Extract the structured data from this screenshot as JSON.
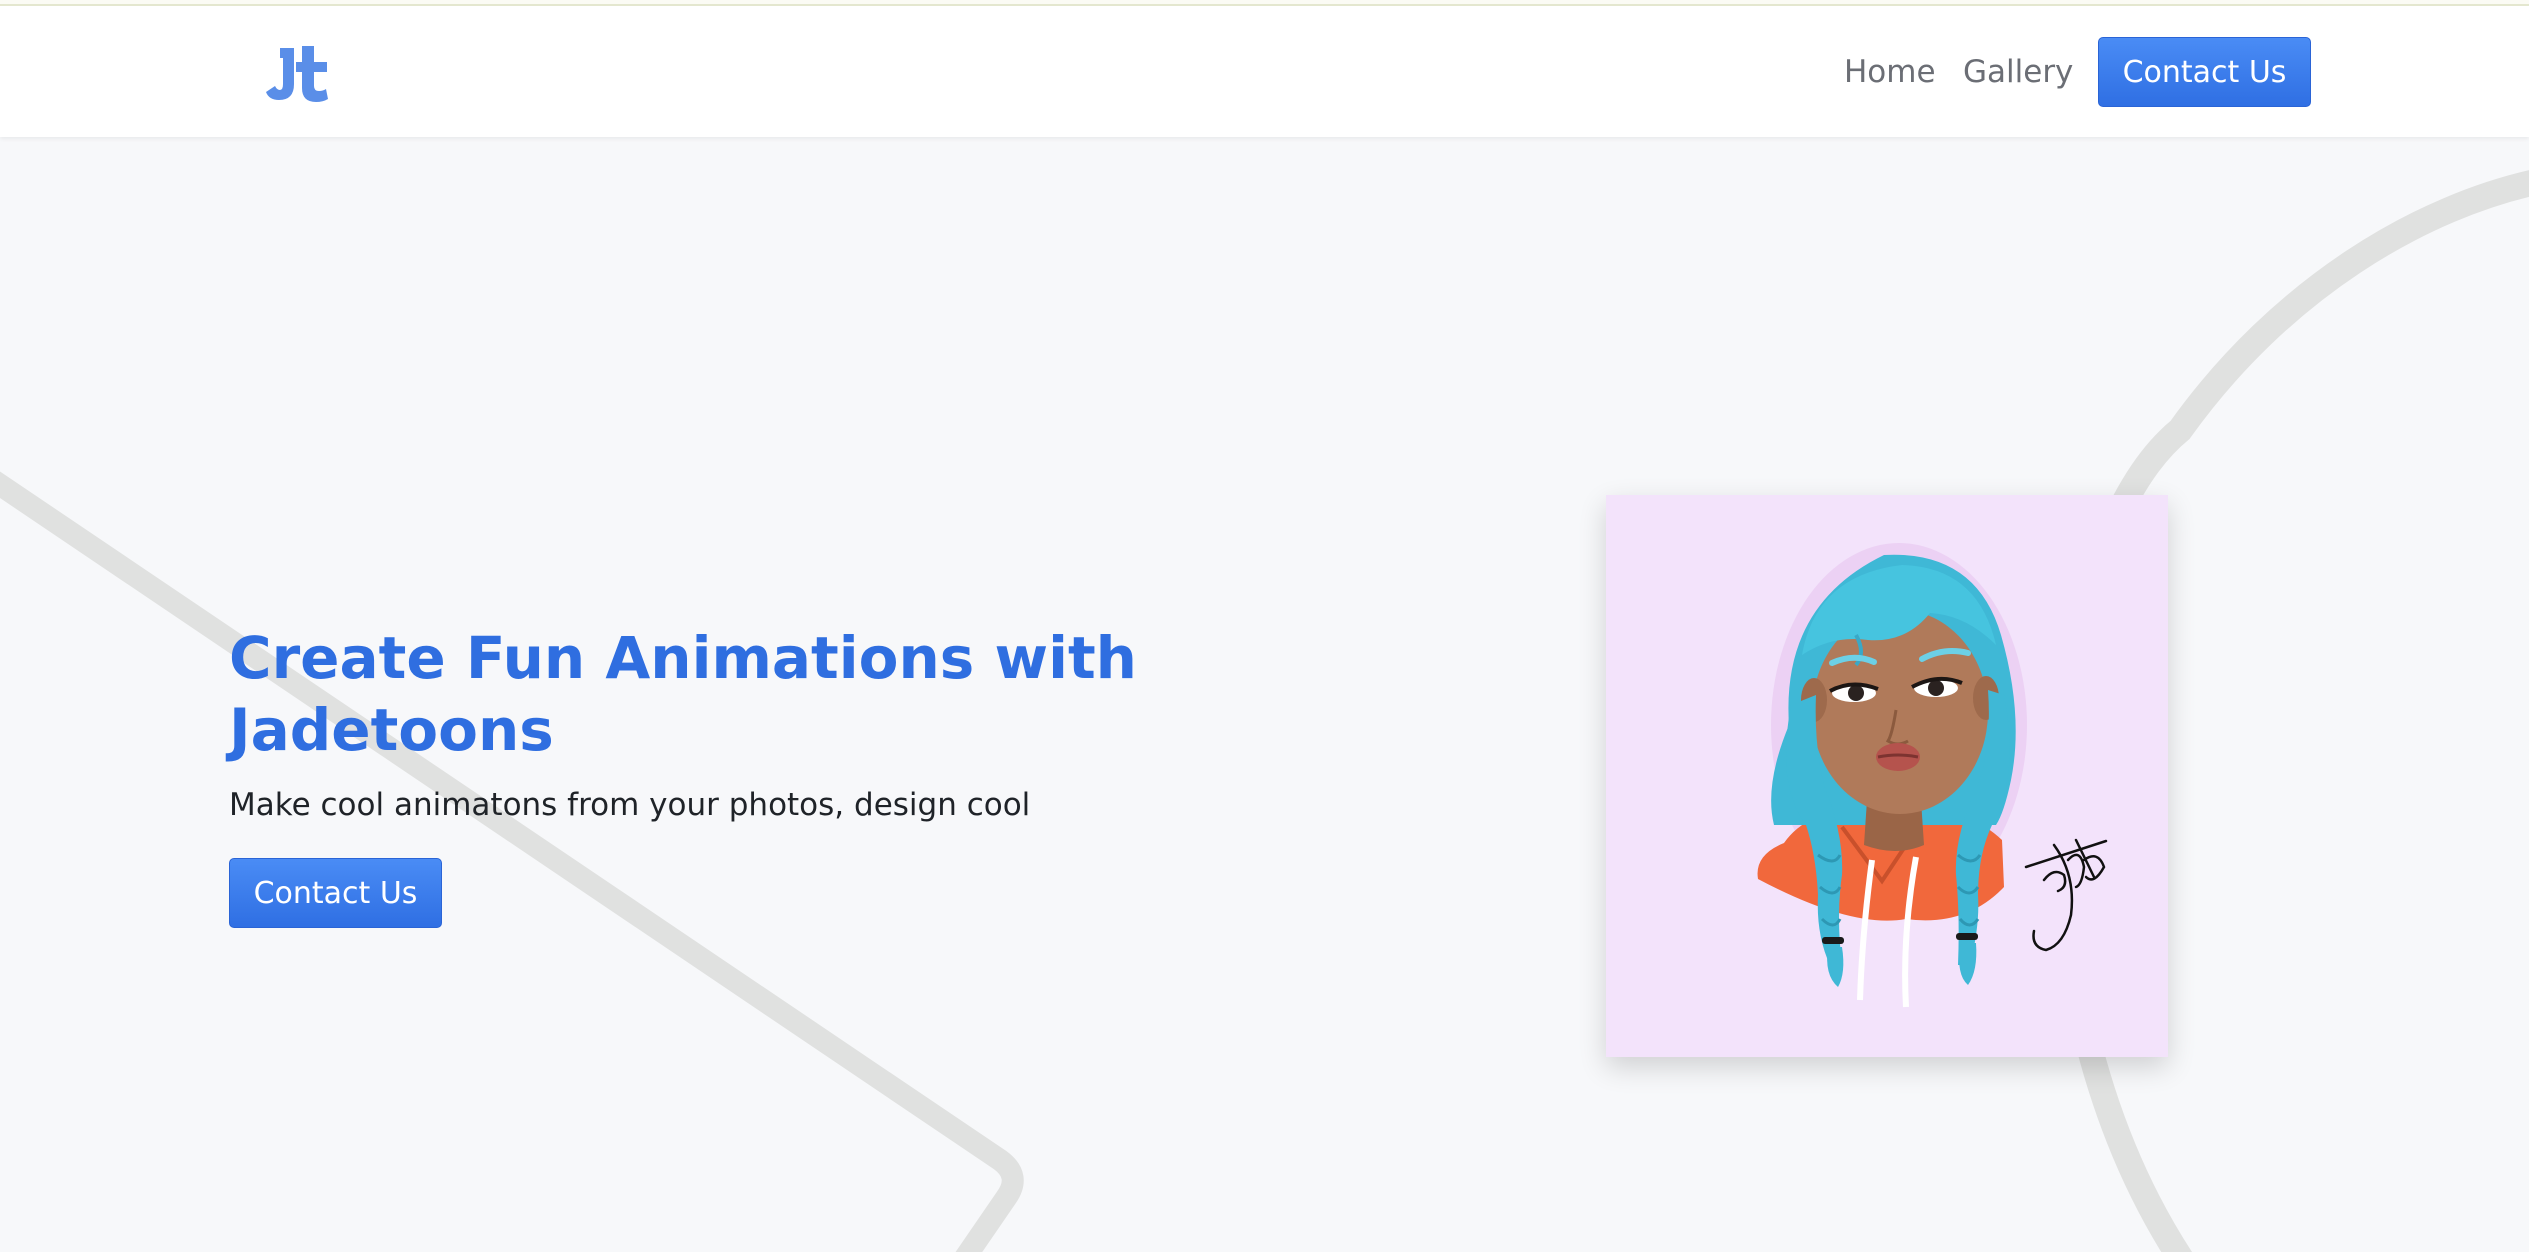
{
  "navbar": {
    "logo": {
      "icon": "jt-monogram-logo",
      "text": "Jt",
      "color": "#5a8ee8"
    },
    "links": [
      {
        "label": "Home"
      },
      {
        "label": "Gallery"
      }
    ],
    "contact_label": "Contact Us"
  },
  "hero": {
    "title": "Create Fun Animations with Jadetoons",
    "subtitle": "Make cool animatons from your photos, design cool",
    "contact_label": "Contact Us",
    "image": {
      "icon": "cartoon-girl-illustration",
      "signature": "Jade",
      "background_color": "#f3e3fb"
    }
  },
  "colors": {
    "accent": "#2f6ee0",
    "button": "#3b7cef",
    "page_background": "#f7f8fa",
    "decor_stroke": "#e0e1e0",
    "hair": "#3fb8d6",
    "hoodie": "#f1683c",
    "skin": "#b07a5a"
  }
}
